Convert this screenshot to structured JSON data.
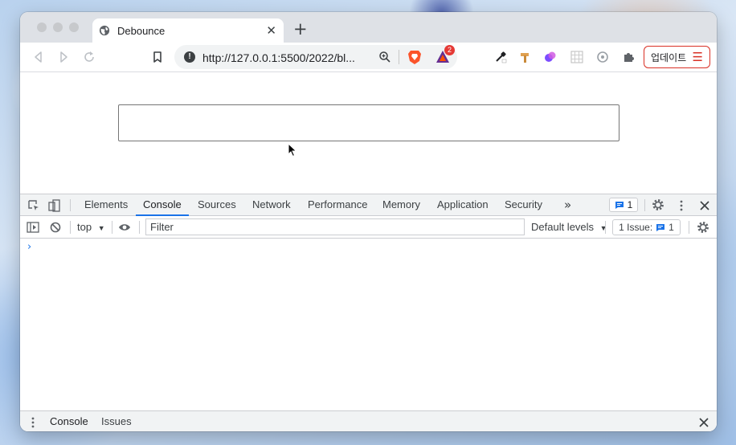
{
  "browser": {
    "tab": {
      "title": "Debounce",
      "close_glyph": "✕",
      "icon": "globe-icon"
    },
    "new_tab_glyph": "+",
    "address": {
      "url": "http://127.0.0.1:5500/2022/bl..."
    },
    "extension_badge_count": "2",
    "update_button": {
      "label": "업데이트",
      "menu_glyph": "☰"
    }
  },
  "page": {
    "input": {
      "value": "",
      "placeholder": ""
    }
  },
  "devtools": {
    "tabs": [
      "Elements",
      "Console",
      "Sources",
      "Network",
      "Performance",
      "Memory",
      "Application",
      "Security"
    ],
    "active_tab": "Console",
    "more_tabs_glyph": "»",
    "message_count": "1",
    "context": "top",
    "filter_placeholder": "Filter",
    "levels": "Default levels",
    "issues": {
      "label": "1 Issue:",
      "count": "1"
    },
    "prompt_glyph": "›",
    "drawer": {
      "tabs": [
        "Console",
        "Issues"
      ],
      "active": "Console",
      "close_glyph": "✕"
    }
  },
  "colors": {
    "accent": "#1a73e8",
    "update_border": "#d93025",
    "devtools_bar": "#f1f3f4"
  }
}
